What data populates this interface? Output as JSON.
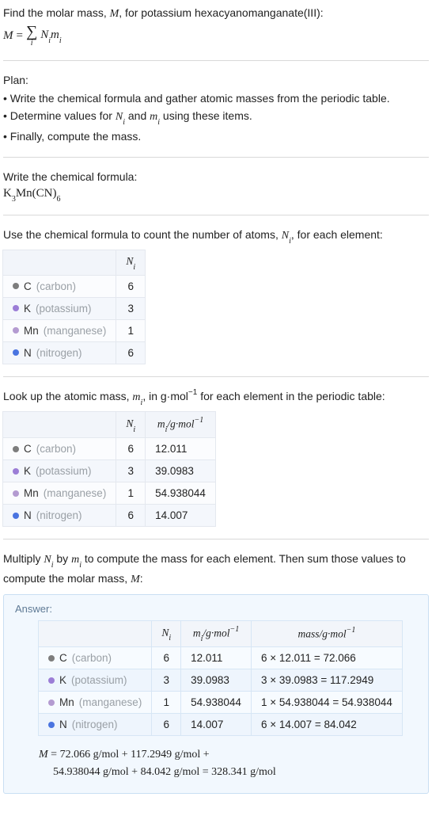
{
  "intro": {
    "line1": "Find the molar mass, ",
    "M": "M",
    "line1b": ", for potassium hexacyanomanganate(III):",
    "eq_lhs": "M",
    "eq_eq": " = ",
    "eq_rhs": "N",
    "eq_i": "i",
    "eq_m": "m"
  },
  "plan": {
    "heading": "Plan:",
    "b1a": "• Write the chemical formula and gather atomic masses from the periodic table.",
    "b2a": "• Determine values for ",
    "b2_N": "N",
    "b2_i": "i",
    "b2b": " and ",
    "b2_m": "m",
    "b2c": " using these items.",
    "b3": "• Finally, compute the mass."
  },
  "s1": {
    "heading": "Write the chemical formula:",
    "chem_K": "K",
    "chem_K_n": "3",
    "chem_Mn": "Mn(CN)",
    "chem_CN_n": "6"
  },
  "s2": {
    "line_a": "Use the chemical formula to count the number of atoms, ",
    "N": "N",
    "i": "i",
    "line_b": ", for each element:",
    "head_blank": "",
    "head_Ni": "N",
    "head_i": "i"
  },
  "elements": [
    {
      "sym": "C",
      "name": "(carbon)",
      "color": "#7d7d7d",
      "N": "6",
      "m": "12.011",
      "mass": "6 × 12.011 = 72.066"
    },
    {
      "sym": "K",
      "name": "(potassium)",
      "color": "#9b7dd6",
      "N": "3",
      "m": "39.0983",
      "mass": "3 × 39.0983 = 117.2949"
    },
    {
      "sym": "Mn",
      "name": "(manganese)",
      "color": "#b49bd1",
      "N": "1",
      "m": "54.938044",
      "mass": "1 × 54.938044 = 54.938044"
    },
    {
      "sym": "N",
      "name": "(nitrogen)",
      "color": "#4a74e0",
      "N": "6",
      "m": "14.007",
      "mass": "6 × 14.007 = 84.042"
    }
  ],
  "s3": {
    "line_a": "Look up the atomic mass, ",
    "m": "m",
    "i": "i",
    "line_b": ", in g·mol",
    "exp": "−1",
    "line_c": " for each element in the periodic table:",
    "head_m": "m",
    "head_unit_a": "/g·mol",
    "head_unit_exp": "−1"
  },
  "s4": {
    "line_a": "Multiply ",
    "N": "N",
    "i": "i",
    "line_b": " by ",
    "m": "m",
    "line_c": " to compute the mass for each element. Then sum those values to compute the molar mass, ",
    "M": "M",
    "line_d": ":"
  },
  "answer": {
    "label": "Answer:",
    "head_mass_a": "mass/g·mol",
    "head_mass_exp": "−1",
    "eq_M": "M",
    "eq_eq": " = ",
    "eq_line1": "72.066 g/mol + 117.2949 g/mol +",
    "eq_line2": "54.938044 g/mol + 84.042 g/mol = 328.341 g/mol"
  }
}
